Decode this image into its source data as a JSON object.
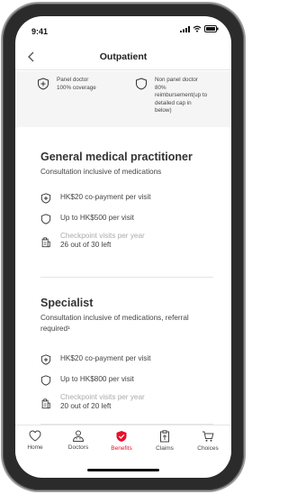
{
  "status_bar": {
    "time": "9:41"
  },
  "nav": {
    "title": "Outpatient"
  },
  "coverage": {
    "panel": "Panel doctor\n100% coverage",
    "non_panel": "Non panel doctor\n80%\nreimbursement(up to\ndetailed cap in\nbelow)"
  },
  "gp": {
    "title": "General medical practitioner",
    "subtitle": "Consultation inclusive of medications",
    "copay": "HK$20 co-payment per visit",
    "cap": "Up to HK$500 per visit",
    "checkpoint_label": "Checkpoint visits per year",
    "checkpoint_value": "26 out of 30 left"
  },
  "specialist": {
    "title": "Specialist",
    "subtitle": "Consultation inclusive of medications, referral required¹",
    "copay": "HK$20 co-payment per visit",
    "cap": "Up to HK$800 per visit",
    "checkpoint_label": "Checkpoint visits per year",
    "checkpoint_value": "20 out of 20 left"
  },
  "tabs": {
    "home": "Home",
    "doctors": "Doctors",
    "benefits": "Benefits",
    "claims": "Claims",
    "choices": "Choices"
  },
  "colors": {
    "accent": "#e8112d"
  }
}
